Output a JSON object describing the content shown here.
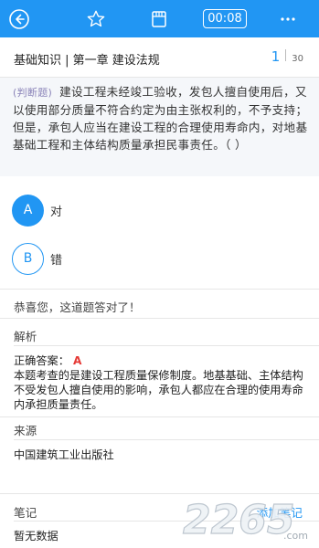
{
  "topbar": {
    "back_icon": "back-circle-icon",
    "favorite_icon": "star-icon",
    "answer_sheet_icon": "answer-sheet-icon",
    "timer": "00:08",
    "more_icon": "more-dots-icon",
    "color": "#2196f3"
  },
  "chapter": {
    "title": "基础知识 | 第一章  建设法规",
    "current": "1",
    "total": "30"
  },
  "question": {
    "type": "(判断题)",
    "text": "建设工程未经竣工验收，发包人擅自使用后，又以使用部分质量不符合约定为由主张权利的，不予支持；但是，承包人应当在建设工程的合理使用寿命内，对地基基础工程和主体结构质量承担民事责任。（ ）"
  },
  "options": [
    {
      "letter": "A",
      "text": "对",
      "selected": true
    },
    {
      "letter": "B",
      "text": "错",
      "selected": false
    }
  ],
  "result_text": "恭喜您，这道题答对了！",
  "analysis": {
    "title": "解析",
    "answer_label": "正确答案：",
    "answer_value": "A",
    "body": "本题考查的是建设工程质量保修制度。地基基础、主体结构不受发包人擅自使用的影响，承包人都应在合理的使用寿命内承担质量责任。"
  },
  "source": {
    "title": "来源",
    "value": "中国建筑工业出版社"
  },
  "notes": {
    "title": "笔记",
    "add_label": "添加笔记",
    "empty_text": "暂无数据"
  },
  "watermark": {
    "text": "2265",
    "sub": ".com"
  }
}
